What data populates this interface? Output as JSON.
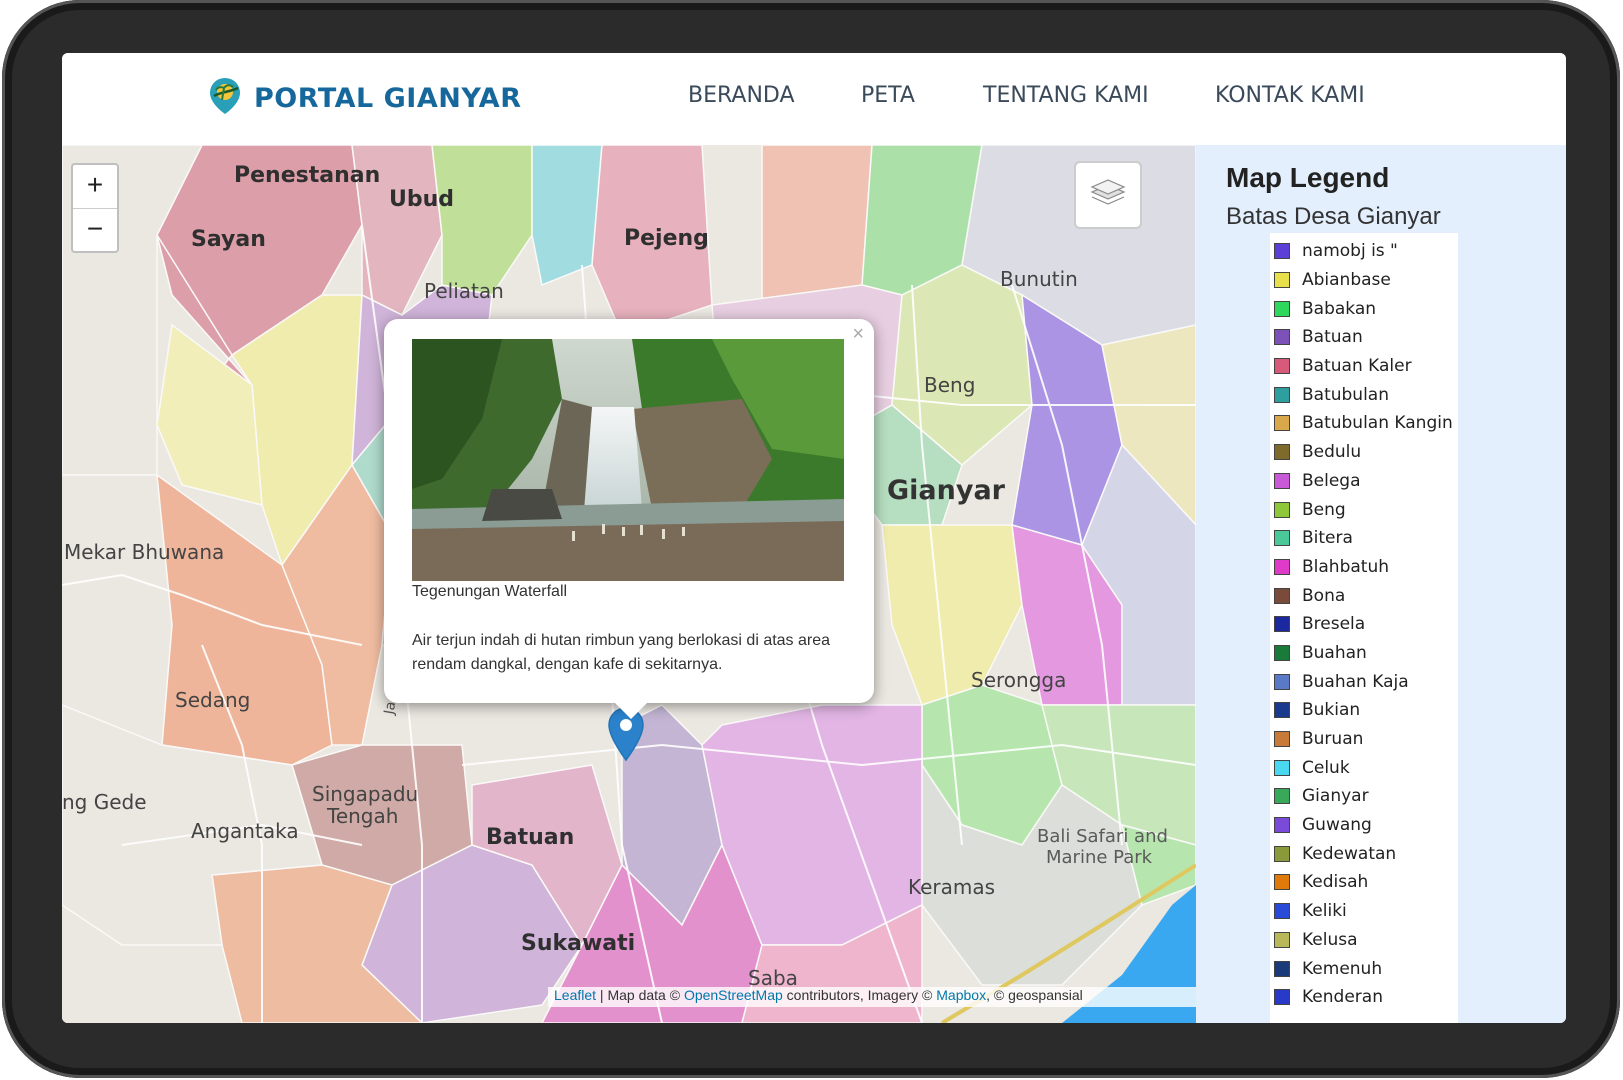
{
  "brand": {
    "title": "PORTAL GIANYAR"
  },
  "nav": {
    "items": [
      "BERANDA",
      "PETA",
      "TENTANG KAMI",
      "KONTAK KAMI"
    ]
  },
  "map": {
    "zoom_in": "+",
    "zoom_out": "−",
    "places": {
      "penestanan": "Penestanan",
      "ubud": "Ubud",
      "sayan": "Sayan",
      "pejeng": "Pejeng",
      "peliatan": "Peliatan",
      "bunutin": "Bunutin",
      "beng": "Beng",
      "gianyar": "Gianyar",
      "mekar_bhuwana": "Mekar Bhuwana",
      "sedang": "Sedang",
      "serongga": "Serongga",
      "singapadu_tengah_1": "Singapadu",
      "singapadu_tengah_2": "Tengah",
      "ng_gede": "ng Gede",
      "angantaka": "Angantaka",
      "batuan": "Batuan",
      "bali_safari_1": "Bali Safari and",
      "bali_safari_2": "Marine Park",
      "keramas": "Keramas",
      "sukawati": "Sukawati",
      "saba": "Saba",
      "jalan": "Ja"
    },
    "attribution": {
      "leaflet": "Leaflet",
      "sep1": " | Map data © ",
      "osm": "OpenStreetMap",
      "sep2": " contributors, Imagery © ",
      "mapbox": "Mapbox",
      "sep3": ", © geospansial"
    }
  },
  "popup": {
    "close": "×",
    "title": "Tegenungan Waterfall",
    "description": "Air terjun indah di hutan rimbun yang berlokasi di atas area rendam dangkal, dengan kafe di sekitarnya."
  },
  "legend": {
    "title": "Map Legend",
    "subtitle": "Batas Desa Gianyar",
    "items": [
      {
        "label": "namobj is \"",
        "color": "#5b3fd6"
      },
      {
        "label": "Abianbase",
        "color": "#e8e04a"
      },
      {
        "label": "Babakan",
        "color": "#2fd85c"
      },
      {
        "label": "Batuan",
        "color": "#7d52b8"
      },
      {
        "label": "Batuan Kaler",
        "color": "#d85a7a"
      },
      {
        "label": "Batubulan",
        "color": "#2f9e9e"
      },
      {
        "label": "Batubulan Kangin",
        "color": "#d8a84a"
      },
      {
        "label": "Bedulu",
        "color": "#7e6a2a"
      },
      {
        "label": "Belega",
        "color": "#c85ad8"
      },
      {
        "label": "Beng",
        "color": "#8ec83a"
      },
      {
        "label": "Bitera",
        "color": "#4ac89a"
      },
      {
        "label": "Blahbatuh",
        "color": "#e03ac8"
      },
      {
        "label": "Bona",
        "color": "#7a4a3a"
      },
      {
        "label": "Bresela",
        "color": "#1a2a9e"
      },
      {
        "label": "Buahan",
        "color": "#1a7a3a"
      },
      {
        "label": "Buahan Kaja",
        "color": "#5a7ac8"
      },
      {
        "label": "Bukian",
        "color": "#1a3a8e"
      },
      {
        "label": "Buruan",
        "color": "#c87a3a"
      },
      {
        "label": "Celuk",
        "color": "#4ad8f0"
      },
      {
        "label": "Gianyar",
        "color": "#3aa85a"
      },
      {
        "label": "Guwang",
        "color": "#7a4ad8"
      },
      {
        "label": "Kedewatan",
        "color": "#8a9a3a"
      },
      {
        "label": "Kedisah",
        "color": "#e07a0a"
      },
      {
        "label": "Keliki",
        "color": "#2a4ad8"
      },
      {
        "label": "Kelusa",
        "color": "#b8b85a"
      },
      {
        "label": "Kemenuh",
        "color": "#1a3a7a"
      },
      {
        "label": "Kenderan",
        "color": "#2a3ac8"
      }
    ]
  }
}
